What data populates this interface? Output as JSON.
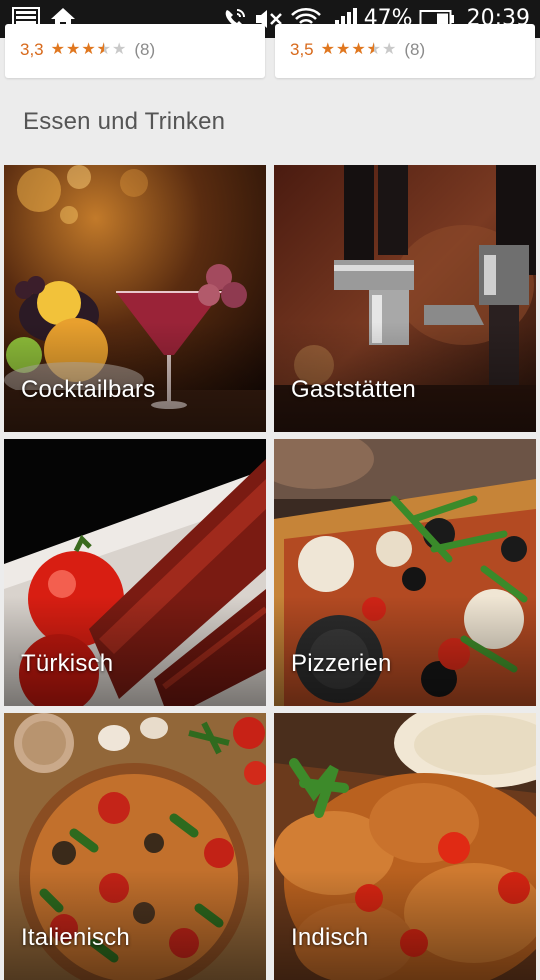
{
  "status_bar": {
    "battery_percent": "47%",
    "time": "20:39",
    "icons": [
      "gallery-icon",
      "home-icon",
      "phone-signal-icon",
      "mute-icon",
      "wifi-icon",
      "cell-signal-icon",
      "battery-icon"
    ]
  },
  "previous_cards": [
    {
      "rating": "3,3",
      "stars": 3.5,
      "count": "(8)"
    },
    {
      "rating": "3,5",
      "stars": 3.5,
      "count": "(8)"
    }
  ],
  "section": {
    "title": "Essen und Trinken",
    "tiles": [
      {
        "label": "Cocktailbars"
      },
      {
        "label": "Gaststätten"
      },
      {
        "label": "Türkisch"
      },
      {
        "label": "Pizzerien"
      },
      {
        "label": "Italienisch"
      },
      {
        "label": "Indisch"
      }
    ]
  }
}
